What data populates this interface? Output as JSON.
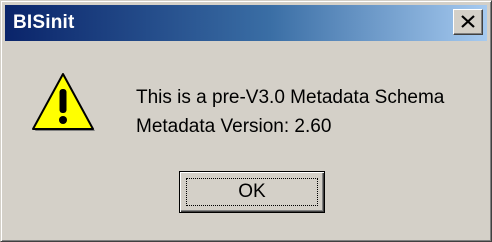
{
  "window": {
    "title": "BISinit"
  },
  "titlebar": {
    "close_icon": "close-icon"
  },
  "dialog": {
    "icon": "warning-icon",
    "message_lines": [
      "This is a pre-V3.0 Metadata Schema",
      "Metadata Version: 2.60"
    ],
    "ok_label": "OK"
  },
  "colors": {
    "titlebar_start": "#0a246a",
    "titlebar_end": "#a6caf0",
    "window_bg": "#d4d0c8",
    "warning_fill": "#ffff00"
  }
}
